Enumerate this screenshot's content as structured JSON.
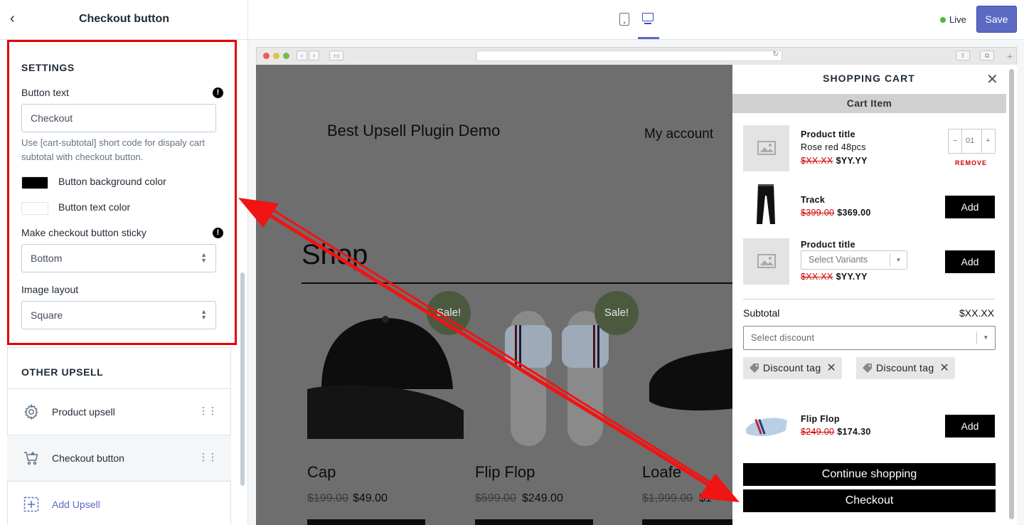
{
  "sidebar": {
    "title": "Checkout button",
    "settings": {
      "heading": "SETTINGS",
      "button_text_label": "Button text",
      "button_text_value": "Checkout",
      "help_text": "Use [cart-subtotal] short code for dispaly cart subtotal with checkout button.",
      "bg_color_label": "Button background color",
      "bg_color": "#000000",
      "text_color_label": "Button text color",
      "text_color": "#ffffff",
      "sticky_label": "Make checkout button sticky",
      "sticky_value": "Bottom",
      "image_layout_label": "Image layout",
      "image_layout_value": "Square",
      "info_glyph": "!"
    },
    "other_upsell": {
      "heading": "OTHER UPSELL",
      "items": [
        {
          "label": "Product upsell",
          "icon": "gear-icon"
        },
        {
          "label": "Checkout button",
          "icon": "cart-icon"
        }
      ],
      "add_label": "Add Upsell"
    }
  },
  "topbar": {
    "status": "Live",
    "status_color": "#50b83c",
    "save_label": "Save",
    "accent": "#5c6ac4"
  },
  "site": {
    "title": "Best Upsell Plugin Demo",
    "nav_account": "My account",
    "heading": "Shop",
    "products": [
      {
        "name": "Cap",
        "old_price": "$199.00",
        "price": "$49.00",
        "badge": "Sale!"
      },
      {
        "name": "Flip Flop",
        "old_price": "$599.00",
        "price": "$249.00",
        "badge": "Sale!"
      },
      {
        "name": "Loafe",
        "old_price": "$1,999.00",
        "price": "$1"
      }
    ]
  },
  "cart": {
    "title": "SHOPPING CART",
    "section_label": "Cart Item",
    "item": {
      "title": "Product title",
      "subtitle": "Rose red 48pcs",
      "old_price": "$XX.XX",
      "price": "$YY.YY",
      "qty": "01",
      "remove": "REMOVE"
    },
    "upsells": [
      {
        "title": "Track",
        "old_price": "$399.00",
        "price": "$369.00",
        "button": "Add"
      },
      {
        "title": "Product title",
        "variant_placeholder": "Select Variants",
        "old_price": "$XX.XX",
        "price": "$YY.YY",
        "button": "Add"
      }
    ],
    "subtotal_label": "Subtotal",
    "subtotal_value": "$XX.XX",
    "discount_placeholder": "Select discount",
    "tags": [
      "Discount tag",
      "Discount tag"
    ],
    "tag_remove": "✕",
    "extra_upsell": {
      "title": "Flip Flop",
      "old_price": "$249.00",
      "price": "$174.30",
      "button": "Add"
    },
    "continue_label": "Continue shopping",
    "checkout_label": "Checkout",
    "close": "✕",
    "qty_minus": "−",
    "qty_plus": "+"
  },
  "colors": {
    "highlight_box": "#e30000",
    "arrow": "#f01414",
    "price_strike": "#d10000"
  }
}
